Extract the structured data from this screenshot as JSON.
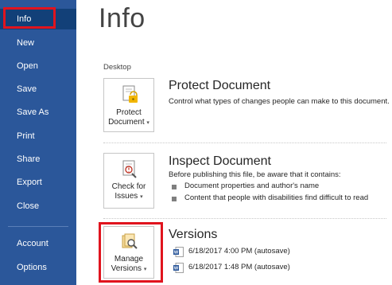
{
  "sidebar": {
    "items": [
      {
        "label": "Info"
      },
      {
        "label": "New"
      },
      {
        "label": "Open"
      },
      {
        "label": "Save"
      },
      {
        "label": "Save As"
      },
      {
        "label": "Print"
      },
      {
        "label": "Share"
      },
      {
        "label": "Export"
      },
      {
        "label": "Close"
      },
      {
        "label": "Account"
      },
      {
        "label": "Options"
      }
    ],
    "active": "Info"
  },
  "main": {
    "title": "Info",
    "location": "Desktop",
    "protect": {
      "button_line1": "Protect",
      "button_line2": "Document",
      "title": "Protect Document",
      "description": "Control what types of changes people can make to this document."
    },
    "inspect": {
      "button_line1": "Check for",
      "button_line2": "Issues",
      "title": "Inspect Document",
      "description": "Before publishing this file, be aware that it contains:",
      "bullets": [
        "Document properties and author's name",
        "Content that people with disabilities find difficult to read"
      ]
    },
    "versions": {
      "button_line1": "Manage",
      "button_line2": "Versions",
      "title": "Versions",
      "entries": [
        "6/18/2017 4:00 PM (autosave)",
        "6/18/2017 1:48 PM (autosave)"
      ]
    }
  },
  "colors": {
    "sidebar": "#2b579a",
    "sidebar_active": "#124078",
    "highlight": "#e0141e"
  }
}
